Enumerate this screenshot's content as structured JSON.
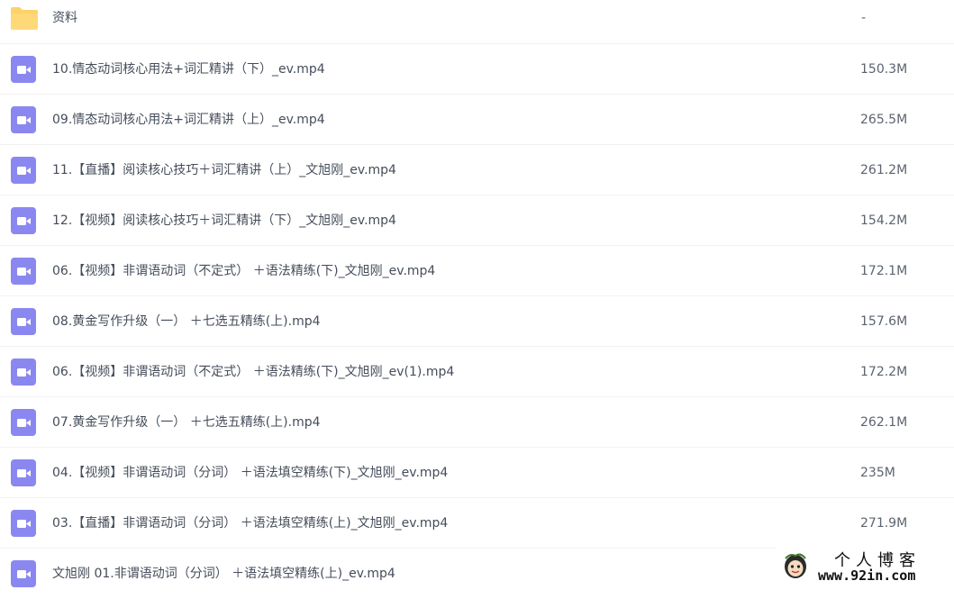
{
  "colors": {
    "folder_icon": "#fcd26a",
    "video_icon": "#8a88f0",
    "text": "#454d5a",
    "divider": "#f1f2f4"
  },
  "files": [
    {
      "name": "资料",
      "size": "-",
      "icon": "folder-icon"
    },
    {
      "name": "10.情态动词核心用法+词汇精讲（下）_ev.mp4",
      "size": "150.3M",
      "icon": "video-file-icon"
    },
    {
      "name": "09.情态动词核心用法+词汇精讲（上）_ev.mp4",
      "size": "265.5M",
      "icon": "video-file-icon"
    },
    {
      "name": "11.【直播】阅读核心技巧＋词汇精讲（上）_文旭刚_ev.mp4",
      "size": "261.2M",
      "icon": "video-file-icon"
    },
    {
      "name": "12.【视频】阅读核心技巧＋词汇精讲（下）_文旭刚_ev.mp4",
      "size": "154.2M",
      "icon": "video-file-icon"
    },
    {
      "name": "06.【视频】非谓语动词（不定式） ＋语法精练(下)_文旭刚_ev.mp4",
      "size": "172.1M",
      "icon": "video-file-icon"
    },
    {
      "name": "08.黄金写作升级（一） ＋七选五精练(上).mp4",
      "size": "157.6M",
      "icon": "video-file-icon"
    },
    {
      "name": "06.【视频】非谓语动词（不定式） ＋语法精练(下)_文旭刚_ev(1).mp4",
      "size": "172.2M",
      "icon": "video-file-icon"
    },
    {
      "name": "07.黄金写作升级（一） ＋七选五精练(上).mp4",
      "size": "262.1M",
      "icon": "video-file-icon"
    },
    {
      "name": "04.【视频】非谓语动词（分词） ＋语法填空精练(下)_文旭刚_ev.mp4",
      "size": "235M",
      "icon": "video-file-icon"
    },
    {
      "name": "03.【直播】非谓语动词（分词） ＋语法填空精练(上)_文旭刚_ev.mp4",
      "size": "271.9M",
      "icon": "video-file-icon"
    },
    {
      "name": "文旭刚 01.非谓语动词（分词） ＋语法填空精练(上)_ev.mp4",
      "size": "",
      "icon": "video-file-icon"
    }
  ],
  "watermark": {
    "title": "个人博客",
    "url": "www.92in.com"
  }
}
